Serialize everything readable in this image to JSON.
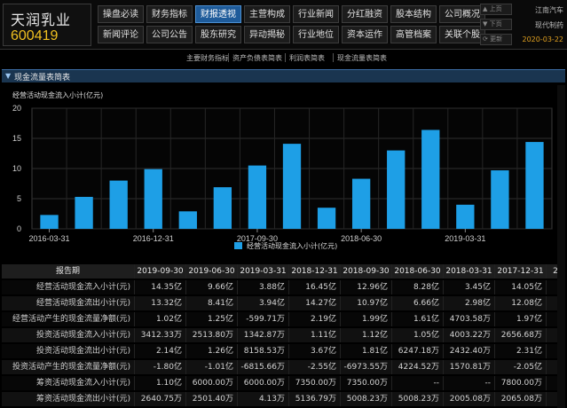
{
  "stock": {
    "name": "天润乳业",
    "code": "600419"
  },
  "tabs": [
    [
      "操盘必读",
      "财务指标",
      "财报透视",
      "主营构成",
      "行业新闻",
      "分红融资",
      "股本结构",
      "公司概况"
    ],
    [
      "新闻评论",
      "公司公告",
      "股东研究",
      "异动揭秘",
      "行业地位",
      "资本运作",
      "高管档案",
      "关联个股"
    ]
  ],
  "active_tab": "财报透视",
  "side": {
    "up_label": "上页",
    "up_text": "江南汽车",
    "down_label": "下页",
    "down_text": "现代制药",
    "refresh_label": "更新",
    "date": "2020-03-22"
  },
  "sub_tabs": [
    "主要财务指标",
    "资产负债表简表",
    "利润表简表",
    "现金流量表简表"
  ],
  "section_title": "现金流量表简表",
  "chart_data": {
    "type": "bar",
    "title": "经营活动现金流入小计(亿元)",
    "legend": "经营活动现金流入小计(亿元)",
    "legend_position": "bottom-center",
    "ylim": [
      0,
      20
    ],
    "yticks": [
      "0",
      "5",
      "10",
      "15",
      "20"
    ],
    "color": "#1e9fe6",
    "values": [
      2.3,
      5.3,
      8.0,
      9.9,
      2.9,
      6.9,
      10.5,
      14.1,
      3.5,
      8.3,
      13.0,
      16.4,
      4.0,
      9.7,
      14.4
    ],
    "x_tick_labels": [
      {
        "label": "2016-03-31",
        "index": 0
      },
      {
        "label": "2016-12-31",
        "index": 3
      },
      {
        "label": "2017-09-30",
        "index": 6
      },
      {
        "label": "2018-06-30",
        "index": 9
      },
      {
        "label": "2019-03-31",
        "index": 12
      }
    ],
    "grid": true
  },
  "table": {
    "headers": [
      "报告期",
      "2019-09-30",
      "2019-06-30",
      "2019-03-31",
      "2018-12-31",
      "2018-09-30",
      "2018-06-30",
      "2018-03-31",
      "2017-12-31",
      "2"
    ],
    "rows": [
      [
        "经营活动现金流入小计(元)",
        "14.35亿",
        "9.66亿",
        "3.88亿",
        "16.45亿",
        "12.96亿",
        "8.28亿",
        "3.45亿",
        "14.05亿",
        ""
      ],
      [
        "经营活动现金流出小计(元)",
        "13.32亿",
        "8.41亿",
        "3.94亿",
        "14.27亿",
        "10.97亿",
        "6.66亿",
        "2.98亿",
        "12.08亿",
        ""
      ],
      [
        "经营活动产生的现金流量净额(元)",
        "1.02亿",
        "1.25亿",
        "-599.71万",
        "2.19亿",
        "1.99亿",
        "1.61亿",
        "4703.58万",
        "1.97亿",
        ""
      ],
      [
        "投资活动现金流入小计(元)",
        "3412.33万",
        "2513.80万",
        "1342.87万",
        "1.11亿",
        "1.12亿",
        "1.05亿",
        "4003.22万",
        "2656.68万",
        ""
      ],
      [
        "投资活动现金流出小计(元)",
        "2.14亿",
        "1.26亿",
        "8158.53万",
        "3.67亿",
        "1.81亿",
        "6247.18万",
        "2432.40万",
        "2.31亿",
        ""
      ],
      [
        "投资活动产生的现金流量净额(元)",
        "-1.80亿",
        "-1.01亿",
        "-6815.66万",
        "-2.55亿",
        "-6973.55万",
        "4224.52万",
        "1570.81万",
        "-2.05亿",
        ""
      ],
      [
        "筹资活动现金流入小计(元)",
        "1.10亿",
        "6000.00万",
        "6000.00万",
        "7350.00万",
        "7350.00万",
        "--",
        "--",
        "7800.00万",
        ""
      ],
      [
        "筹资活动现金流出小计(元)",
        "2640.75万",
        "2501.40万",
        "4.13万",
        "5136.79万",
        "5008.23万",
        "5008.23万",
        "2005.08万",
        "2065.08万",
        ""
      ]
    ]
  }
}
